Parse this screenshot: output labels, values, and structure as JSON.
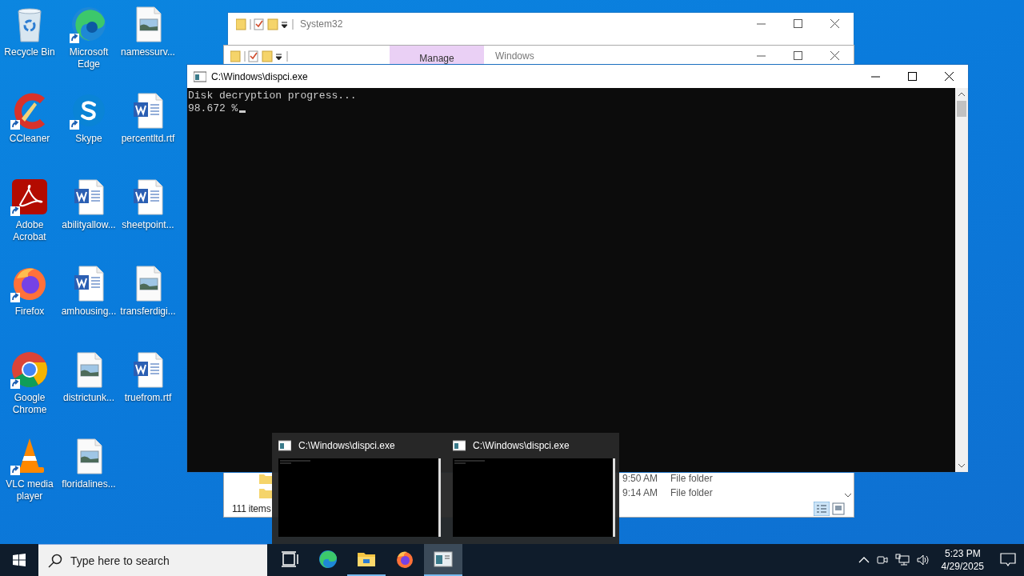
{
  "desktop_icons": [
    {
      "label": "Recycle Bin",
      "kind": "recycle",
      "shortcut": false
    },
    {
      "label": "CCleaner",
      "kind": "ccleaner",
      "shortcut": true
    },
    {
      "label": "Adobe Acrobat",
      "kind": "acrobat",
      "shortcut": true
    },
    {
      "label": "Firefox",
      "kind": "firefox",
      "shortcut": true
    },
    {
      "label": "Google Chrome",
      "kind": "chrome",
      "shortcut": true
    },
    {
      "label": "VLC media player",
      "kind": "vlc",
      "shortcut": true
    },
    {
      "label": "Microsoft Edge",
      "kind": "edge",
      "shortcut": true
    },
    {
      "label": "Skype",
      "kind": "skype",
      "shortcut": true
    },
    {
      "label": "abilityallow...",
      "kind": "word",
      "shortcut": false
    },
    {
      "label": "amhousing...",
      "kind": "word",
      "shortcut": false
    },
    {
      "label": "districtunk...",
      "kind": "image",
      "shortcut": false
    },
    {
      "label": "floridalines...",
      "kind": "image",
      "shortcut": false
    },
    {
      "label": "namessurv...",
      "kind": "image",
      "shortcut": false
    },
    {
      "label": "percentltd.rtf",
      "kind": "word",
      "shortcut": false
    },
    {
      "label": "sheetpoint...",
      "kind": "word",
      "shortcut": false
    },
    {
      "label": "transferdigi...",
      "kind": "image",
      "shortcut": false
    },
    {
      "label": "truefrom.rtf",
      "kind": "word",
      "shortcut": false
    }
  ],
  "explorer_back": {
    "title": "System32"
  },
  "explorer_front": {
    "title": "Windows",
    "context_tab": "Manage",
    "rows": [
      {
        "modified": "9:50 AM",
        "type": "File folder"
      },
      {
        "modified": "9:14 AM",
        "type": "File folder"
      }
    ],
    "status": "111 items"
  },
  "console": {
    "title": "C:\\Windows\\dispci.exe",
    "lines": [
      "Disk decryption progress...",
      "98.672 %"
    ]
  },
  "taskbar_previews": [
    {
      "title": "C:\\Windows\\dispci.exe"
    },
    {
      "title": "C:\\Windows\\dispci.exe"
    }
  ],
  "taskbar": {
    "search": {
      "placeholder": "Type here to search"
    },
    "apps": [
      {
        "kind": "taskview",
        "running": false,
        "active": false
      },
      {
        "kind": "edge",
        "running": false,
        "active": false
      },
      {
        "kind": "explorer",
        "running": true,
        "active": false
      },
      {
        "kind": "firefox",
        "running": false,
        "active": false
      },
      {
        "kind": "console",
        "running": true,
        "active": true
      }
    ],
    "time": "5:23 PM",
    "date": "4/29/2025"
  }
}
